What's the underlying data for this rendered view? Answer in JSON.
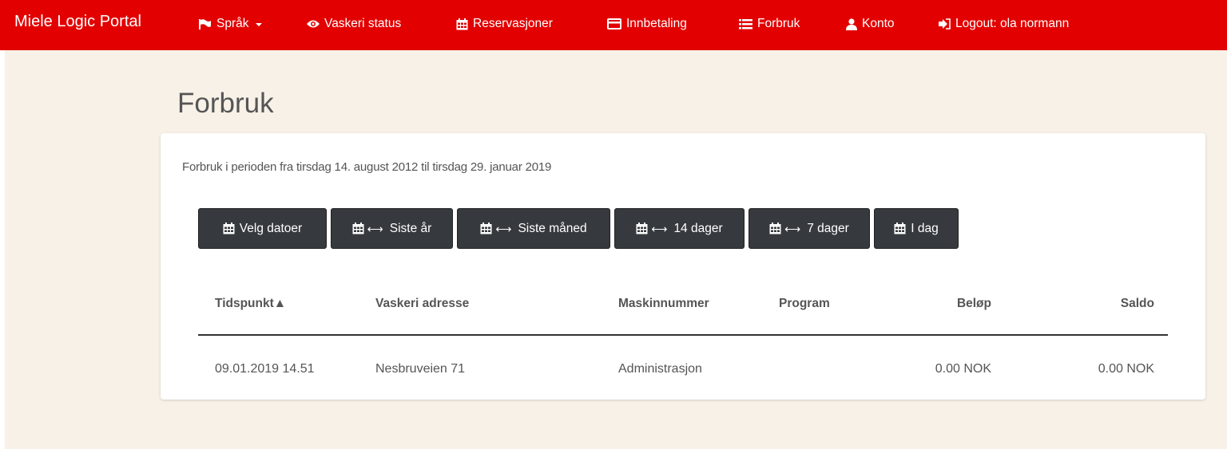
{
  "navbar": {
    "brand": "Miele Logic Portal",
    "items": [
      {
        "label": "Språk",
        "icon": "flag-icon",
        "dropdown": true
      },
      {
        "label": "Vaskeri status",
        "icon": "eye-icon"
      },
      {
        "label": "Reservasjoner",
        "icon": "calendar-icon"
      },
      {
        "label": "Innbetaling",
        "icon": "credit-card-icon"
      },
      {
        "label": "Forbruk",
        "icon": "list-icon"
      },
      {
        "label": "Konto",
        "icon": "user-icon"
      },
      {
        "label": "Logout: ola normann",
        "icon": "logout-icon"
      }
    ]
  },
  "page": {
    "title": "Forbruk",
    "period_text": "Forbruk i perioden fra tirsdag 14. august 2012 til tirsdag 29. januar 2019"
  },
  "buttons": [
    {
      "label": "Velg datoer",
      "icon": "calendar-icon",
      "range": false
    },
    {
      "label": "Siste år",
      "icon": "calendar-icon",
      "range": true
    },
    {
      "label": "Siste måned",
      "icon": "calendar-icon",
      "range": true
    },
    {
      "label": "14 dager",
      "icon": "calendar-icon",
      "range": true
    },
    {
      "label": "7 dager",
      "icon": "calendar-icon",
      "range": true
    },
    {
      "label": "I dag",
      "icon": "calendar-icon",
      "range": false
    }
  ],
  "table": {
    "columns": [
      "Tidspunkt▲",
      "Vaskeri adresse",
      "Maskinnummer",
      "Program",
      "Beløp",
      "Saldo"
    ],
    "rows": [
      [
        "09.01.2019 14.51",
        "Nesbruveien 71",
        "Administrasjon",
        "",
        "0.00 NOK",
        "0.00 NOK"
      ]
    ]
  },
  "colors": {
    "navbar": "#e20000",
    "background": "#f7f1e7",
    "button": "#363a3e",
    "panel": "#ffffff"
  }
}
